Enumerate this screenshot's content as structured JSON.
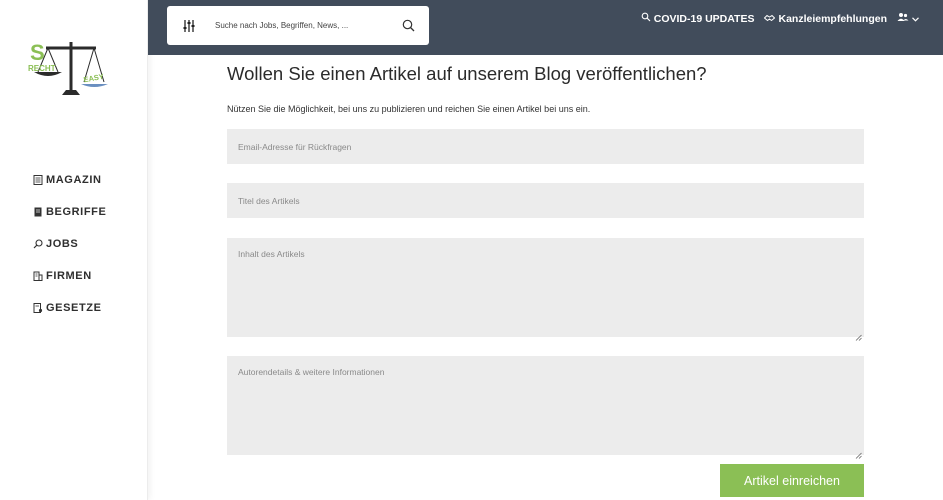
{
  "logo": {
    "text_top": "RECHT",
    "text_bottom": "EASY",
    "letter": "S"
  },
  "sidebar": {
    "items": [
      {
        "label": "MAGAZIN",
        "icon": "newspaper-icon"
      },
      {
        "label": "BEGRIFFE",
        "icon": "book-icon"
      },
      {
        "label": "JOBS",
        "icon": "search-icon"
      },
      {
        "label": "FIRMEN",
        "icon": "building-icon"
      },
      {
        "label": "GESETZE",
        "icon": "law-document-icon"
      }
    ]
  },
  "topbar": {
    "search_placeholder": "Suche nach Jobs, Begriffen, News, ...",
    "covid_label": "COVID-19 UPDATES",
    "kanzlei_label": "Kanzleiempfehlungen"
  },
  "main": {
    "title": "Wollen Sie einen Artikel auf unserem Blog veröffentlichen?",
    "intro": "Nützen Sie die Möglichkeit, bei uns zu publizieren und reichen Sie einen Artikel bei uns ein.",
    "email_placeholder": "Email-Adresse für Rückfragen",
    "title_placeholder": "Titel des Artikels",
    "content_placeholder": "Inhalt des Artikels",
    "author_placeholder": "Autorendetails & weitere Informationen",
    "submit_label": "Artikel einreichen"
  },
  "colors": {
    "topbar": "#414c5b",
    "accent_green": "#8bbf55",
    "field_bg": "#ececec"
  }
}
